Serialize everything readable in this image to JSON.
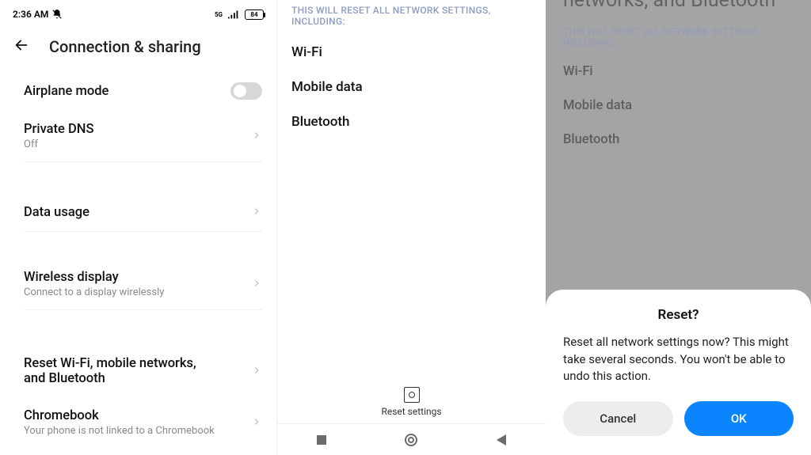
{
  "pane1": {
    "status": {
      "time": "2:36 AM",
      "battery": "84"
    },
    "title": "Connection & sharing",
    "rows": {
      "airplane": {
        "label": "Airplane mode"
      },
      "dns": {
        "label": "Private DNS",
        "sub": "Off"
      },
      "data": {
        "label": "Data usage"
      },
      "wifidisp": {
        "label": "Wireless display",
        "sub": "Connect to a display wirelessly"
      },
      "reset": {
        "label": "Reset Wi-Fi, mobile networks, and Bluetooth"
      },
      "chrome": {
        "label": "Chromebook",
        "sub": "Your phone is not linked to a Chromebook"
      }
    }
  },
  "pane2": {
    "hint": "THIS WILL RESET ALL NETWORK SETTINGS, INCLUDING:",
    "items": {
      "wifi": "Wi-Fi",
      "mobile": "Mobile data",
      "bt": "Bluetooth"
    },
    "reset_btn": "Reset settings"
  },
  "pane3": {
    "title_cut": "networks, and Bluetooth",
    "hint": "THIS WILL RESET ALL NETWORK SETTINGS, INCLUDING:",
    "items": {
      "wifi": "Wi-Fi",
      "mobile": "Mobile data",
      "bt": "Bluetooth"
    },
    "dialog": {
      "title": "Reset?",
      "message": "Reset all network settings now? This might take several seconds. You won't be able to undo this action.",
      "cancel": "Cancel",
      "ok": "OK"
    }
  }
}
